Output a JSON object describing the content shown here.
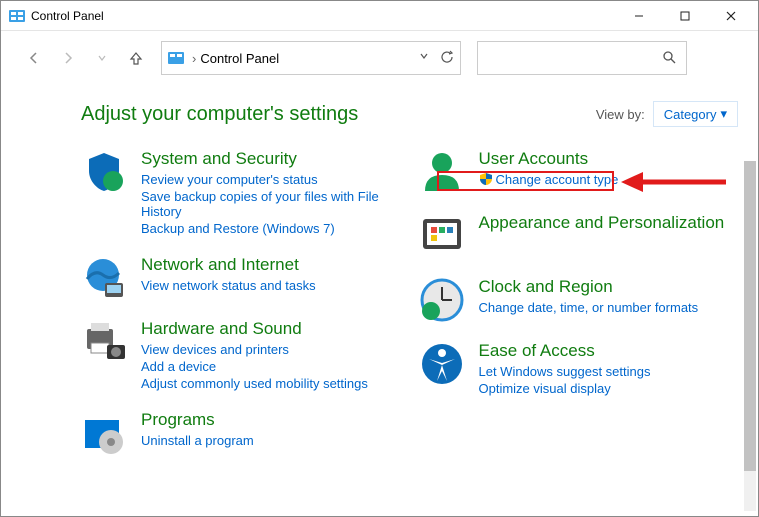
{
  "window": {
    "title": "Control Panel"
  },
  "breadcrumb": {
    "current": "Control Panel"
  },
  "header": {
    "heading": "Adjust your computer's settings",
    "view_by_label": "View by:",
    "view_by_value": "Category"
  },
  "categories": {
    "left": [
      {
        "title": "System and Security",
        "icon": "shield-security-icon",
        "links": [
          "Review your computer's status",
          "Save backup copies of your files with File History",
          "Backup and Restore (Windows 7)"
        ]
      },
      {
        "title": "Network and Internet",
        "icon": "globe-network-icon",
        "links": [
          "View network status and tasks"
        ]
      },
      {
        "title": "Hardware and Sound",
        "icon": "printer-hardware-icon",
        "links": [
          "View devices and printers",
          "Add a device",
          "Adjust commonly used mobility settings"
        ]
      },
      {
        "title": "Programs",
        "icon": "programs-icon",
        "links": [
          "Uninstall a program"
        ]
      }
    ],
    "right": [
      {
        "title": "User Accounts",
        "icon": "user-account-icon",
        "links": [
          "Change account type"
        ],
        "shield_on_first": true
      },
      {
        "title": "Appearance and Personalization",
        "icon": "appearance-icon",
        "links": []
      },
      {
        "title": "Clock and Region",
        "icon": "clock-icon",
        "sub": "Change date, time, or number formats"
      },
      {
        "title": "Ease of Access",
        "icon": "accessibility-icon",
        "sub": "Let Windows suggest settings",
        "links": [
          "Optimize visual display"
        ]
      }
    ]
  }
}
